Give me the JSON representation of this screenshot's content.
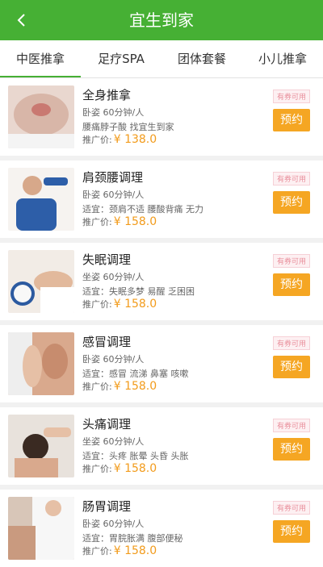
{
  "header": {
    "title": "宜生到家",
    "back_icon": "chevron-left-icon"
  },
  "tabs": [
    {
      "label": "中医推拿",
      "active": true
    },
    {
      "label": "足疗SPA",
      "active": false
    },
    {
      "label": "团体套餐",
      "active": false
    },
    {
      "label": "小儿推拿",
      "active": false
    }
  ],
  "services": [
    {
      "name": "全身推拿",
      "duration": "卧姿 60分钟/人",
      "desc": "腰痛脖子酸 找宜生到家",
      "price_label": "推广价:",
      "price": "¥ 138.0",
      "badge": "有券可用",
      "button": "预约"
    },
    {
      "name": "肩颈腰调理",
      "duration": "卧姿 60分钟/人",
      "desc": "适宜：颈肩不适 腰酸背痛 无力",
      "price_label": "推广价:",
      "price": "¥ 158.0",
      "badge": "有券可用",
      "button": "预约"
    },
    {
      "name": "失眠调理",
      "duration": "坐姿 60分钟/人",
      "desc": "适宜：失眠多梦 易醒 乏困困",
      "price_label": "推广价:",
      "price": "¥ 158.0",
      "badge": "有券可用",
      "button": "预约"
    },
    {
      "name": "感冒调理",
      "duration": "卧姿 60分钟/人",
      "desc": "适宜：感冒 流涕 鼻塞 咳嗽",
      "price_label": "推广价:",
      "price": "¥ 158.0",
      "badge": "有券可用",
      "button": "预约"
    },
    {
      "name": "头痛调理",
      "duration": "坐姿 60分钟/人",
      "desc": "适宜：头疼 胀晕 头昏 头胀",
      "price_label": "推广价:",
      "price": "¥ 158.0",
      "badge": "有券可用",
      "button": "预约"
    },
    {
      "name": "肠胃调理",
      "duration": "卧姿 60分钟/人",
      "desc": "适宜：胃脘胀满 腹部便秘",
      "price_label": "推广价:",
      "price": "¥ 158.0",
      "badge": "有券可用",
      "button": "预约"
    }
  ]
}
